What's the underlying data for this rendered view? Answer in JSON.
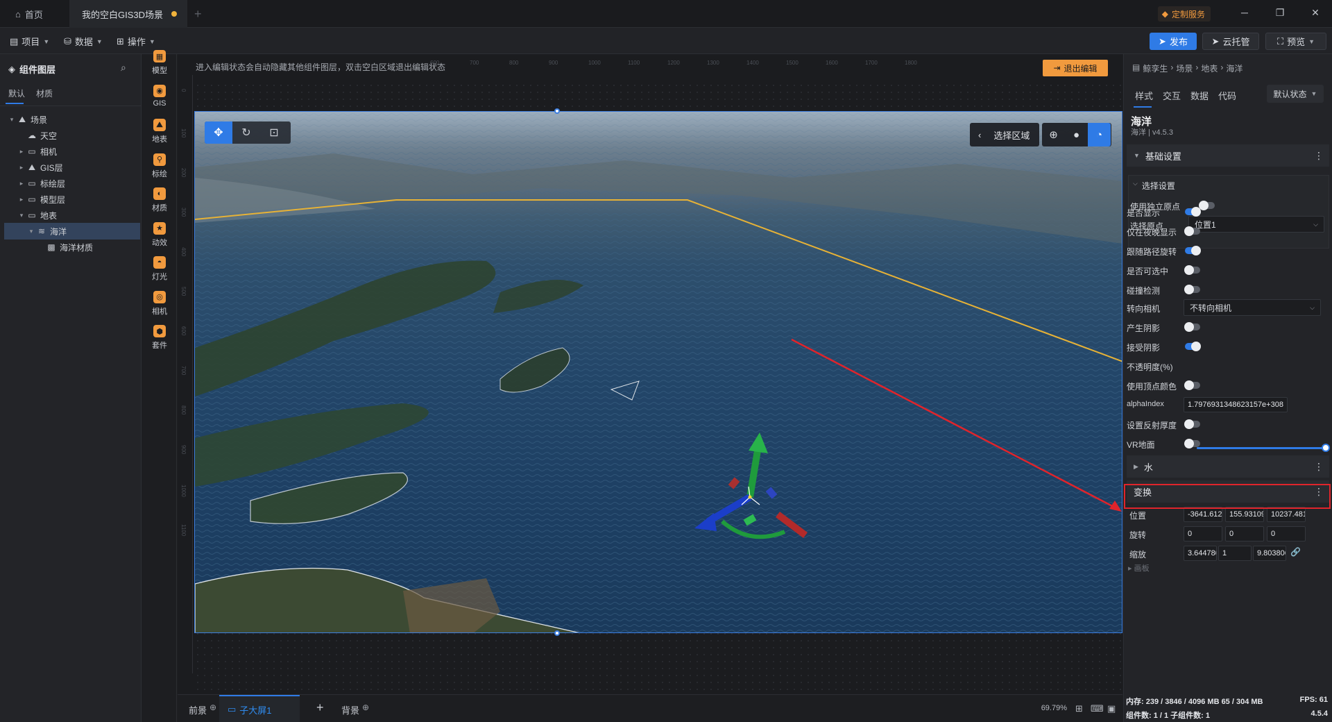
{
  "titlebar": {
    "home_tab": "首页",
    "scene_tab": "我的空白GIS3D场景",
    "custom_service": "定制服务",
    "min": "─",
    "restore": "❐",
    "close": "✕"
  },
  "menubar": {
    "project": "项目",
    "data": "数据",
    "operate": "操作",
    "publish": "发布",
    "cloud_host": "云托管",
    "preview": "预览"
  },
  "left_panel": {
    "title": "组件图层",
    "tabs": [
      "默认",
      "材质"
    ],
    "tree": [
      {
        "label": "场景",
        "icon": "scene-icon",
        "arrow": "▾"
      },
      {
        "label": "天空",
        "icon": "sky-icon",
        "arrow": ""
      },
      {
        "label": "相机",
        "icon": "folder-icon",
        "arrow": "▸"
      },
      {
        "label": "GIS层",
        "icon": "gis-layer-icon",
        "arrow": "▸"
      },
      {
        "label": "标绘层",
        "icon": "folder-icon",
        "arrow": "▸"
      },
      {
        "label": "模型层",
        "icon": "folder-icon",
        "arrow": "▸"
      },
      {
        "label": "地表",
        "icon": "folder-icon",
        "arrow": "▾"
      },
      {
        "label": "海洋",
        "icon": "ocean-icon",
        "arrow": "▾"
      },
      {
        "label": "海洋材质",
        "icon": "material-icon",
        "arrow": ""
      }
    ]
  },
  "tools": [
    "模型",
    "GIS",
    "地表",
    "标绘",
    "材质",
    "动效",
    "灯光",
    "相机",
    "套件"
  ],
  "canvas": {
    "hint": "进入编辑状态会自动隐藏其他组件图层，双击空白区域退出编辑状态",
    "exit_edit": "退出编辑",
    "ruler_top": [
      "600",
      "700",
      "800",
      "900",
      "1000",
      "1100",
      "1200",
      "1300",
      "1400",
      "1500",
      "1600",
      "1700",
      "1800"
    ],
    "ruler_left": [
      "0",
      "100",
      "200",
      "300",
      "400",
      "500",
      "600",
      "700",
      "800",
      "900",
      "1000",
      "1100"
    ],
    "select_region": "选择区域"
  },
  "bottombar": {
    "foreground": "前景",
    "child_screen": "子大屏1",
    "add": "+",
    "background": "背景",
    "zoom": "69.79%"
  },
  "right_panel": {
    "breadcrumb": [
      "鲸孪生",
      "场景",
      "地表",
      "海洋"
    ],
    "tabs": [
      "样式",
      "交互",
      "数据",
      "代码"
    ],
    "state_select": "默认状态",
    "component_name": "海洋",
    "component_version": "海洋 | v4.5.3",
    "section_basic": "基础设置",
    "section_select": "选择设置",
    "use_origin": "使用独立原点",
    "select_origin": "选择原点",
    "origin_value": "位置1",
    "props": [
      {
        "label": "是否显示",
        "on": true
      },
      {
        "label": "仅在夜晚显示",
        "on": false
      },
      {
        "label": "跟随路径旋转",
        "on": true
      },
      {
        "label": "是否可选中",
        "on": false
      },
      {
        "label": "碰撞检测",
        "on": false
      }
    ],
    "face_camera": "转向相机",
    "face_camera_value": "不转向相机",
    "props2": [
      {
        "label": "产生阴影",
        "on": false
      },
      {
        "label": "接受阴影",
        "on": true
      }
    ],
    "opacity_label": "不透明度(%)",
    "opacity_value": 100,
    "vertex_color": "使用顶点颜色",
    "alpha_label": "alphaIndex",
    "alpha_value": "1.7976931348623157e+308",
    "reflect": "设置反射厚度",
    "vr_ground": "VR地面",
    "section_water": "水",
    "section_transform": "变换",
    "position_label": "位置",
    "position": [
      "-3641.612",
      "155.93109",
      "10237.481"
    ],
    "rotation_label": "旋转",
    "rotation": [
      "0",
      "0",
      "0"
    ],
    "scale_label": "缩放",
    "scale": [
      "3.644780",
      "1",
      "9.803806"
    ],
    "hidden_section": "画板"
  },
  "status": {
    "memory": "内存: 239 / 3846 / 4096 MB  65 / 304 MB",
    "fps": "FPS:  61",
    "components": "组件数: 1 / 1    子组件数: 1",
    "version": "4.5.4"
  },
  "colors": {
    "accent": "#2f7be6",
    "warning": "#f19a3e",
    "highlight_box": "#e0242b",
    "selection_line": "#e7b236"
  }
}
